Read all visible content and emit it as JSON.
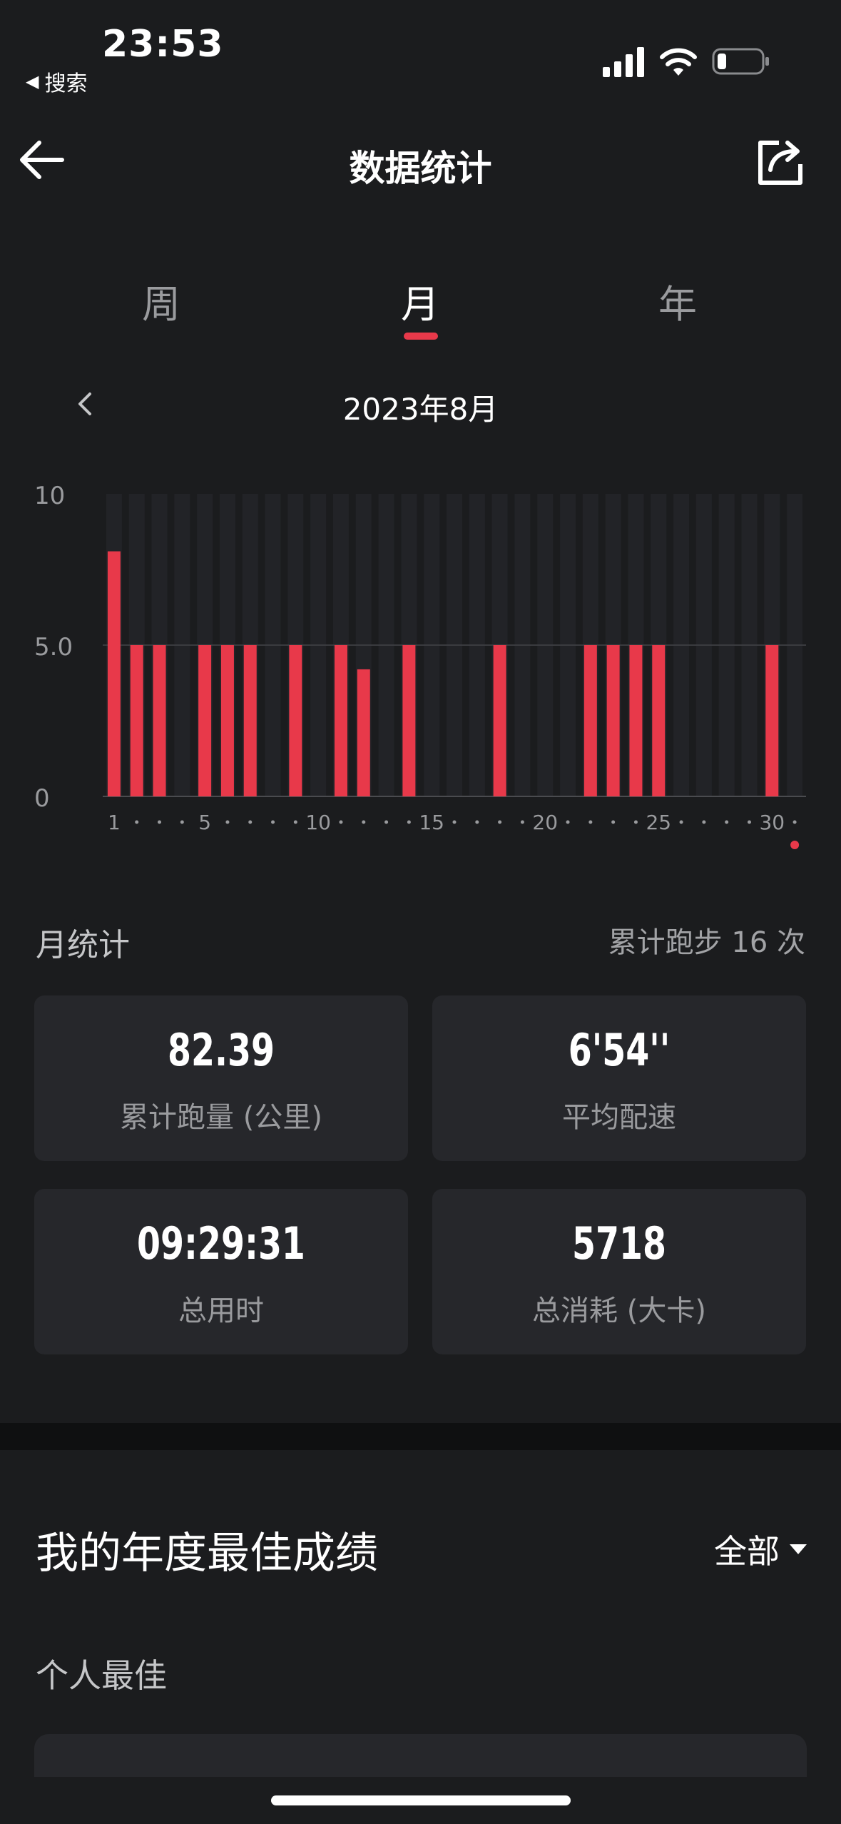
{
  "status_bar": {
    "time": "23:53",
    "back_label": "搜索",
    "back_icon": "◀"
  },
  "nav": {
    "title": "数据统计"
  },
  "tabs": [
    {
      "label": "周",
      "active": false
    },
    {
      "label": "月",
      "active": true
    },
    {
      "label": "年",
      "active": false
    }
  ],
  "period": {
    "label": "2023年8月"
  },
  "colors": {
    "accent": "#e8394a",
    "card_bg": "#26272b",
    "page_bg": "#1b1c1e"
  },
  "chart_data": {
    "type": "bar",
    "title": "",
    "xlabel": "",
    "ylabel": "",
    "ylim": [
      0,
      10
    ],
    "y_ticks": [
      "10",
      "5.0",
      "0"
    ],
    "x": [
      1,
      2,
      3,
      4,
      5,
      6,
      7,
      8,
      9,
      10,
      11,
      12,
      13,
      14,
      15,
      16,
      17,
      18,
      19,
      20,
      21,
      22,
      23,
      24,
      25,
      26,
      27,
      28,
      29,
      30,
      31
    ],
    "x_tick_labels": [
      "1",
      "5",
      "10",
      "15",
      "20",
      "25",
      "30"
    ],
    "values": [
      8.1,
      5.0,
      5.0,
      0,
      5.0,
      5.0,
      5.0,
      0,
      5.0,
      0,
      5.0,
      4.2,
      0,
      5.0,
      0,
      0,
      0,
      5.0,
      0,
      0,
      0,
      5.0,
      5.0,
      5.0,
      5.0,
      0,
      0,
      0,
      0,
      5.0,
      0
    ],
    "grid": true
  },
  "month_stats": {
    "title": "月统计",
    "count_text": "累计跑步 16 次",
    "cards": [
      {
        "value": "82.39",
        "label": "累计跑量 (公里)"
      },
      {
        "value": "6'54''",
        "label": "平均配速"
      },
      {
        "value": "09:29:31",
        "label": "总用时"
      },
      {
        "value": "5718",
        "label": "总消耗 (大卡)"
      }
    ]
  },
  "best": {
    "title": "我的年度最佳成绩",
    "filter_label": "全部",
    "personal_best_label": "个人最佳"
  }
}
